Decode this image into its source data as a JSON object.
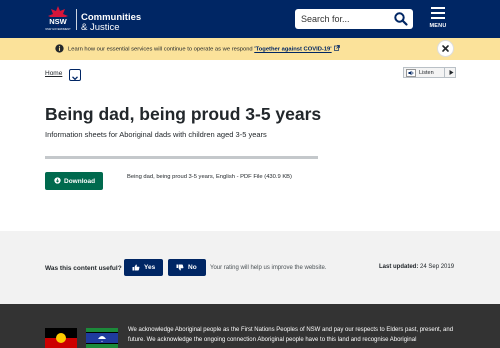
{
  "header": {
    "logo_text": "NSW GOVERNMENT",
    "brand_line1": "Communities",
    "brand_line2": "& Justice",
    "search_placeholder": "Search for...",
    "menu_label": "MENU",
    "background_color": "#002664"
  },
  "alert": {
    "text": "Learn how our essential services will continue to operate as we respond",
    "link_text": "'Together against COVID-19'",
    "background_color": "#fbe29a",
    "icons": [
      "info-icon",
      "external-link-icon",
      "close-icon"
    ]
  },
  "breadcrumb": {
    "home_label": "Home"
  },
  "listen": {
    "label": "Listen"
  },
  "main": {
    "title": "Being dad, being proud 3-5 years",
    "intro": "Information sheets for Aboriginal dads with children aged 3-5 years",
    "download_label": "Download",
    "file_description": "Being dad, being proud 3-5 years, English - PDF File (430.9 KB)",
    "download_color": "#006a4e"
  },
  "feedback": {
    "question": "Was this content useful?",
    "yes_label": "Yes",
    "no_label": "No",
    "help_text": "Your rating will help us improve the website.",
    "updated_label": "Last updated:",
    "updated_date": "24 Sep 2019"
  },
  "footer": {
    "acknowledgement": "We acknowledge Aboriginal people as the First Nations Peoples of NSW and pay our respects to Elders past, present, and future. We acknowledge the ongoing connection Aboriginal people have to this land and recognise Aboriginal"
  }
}
